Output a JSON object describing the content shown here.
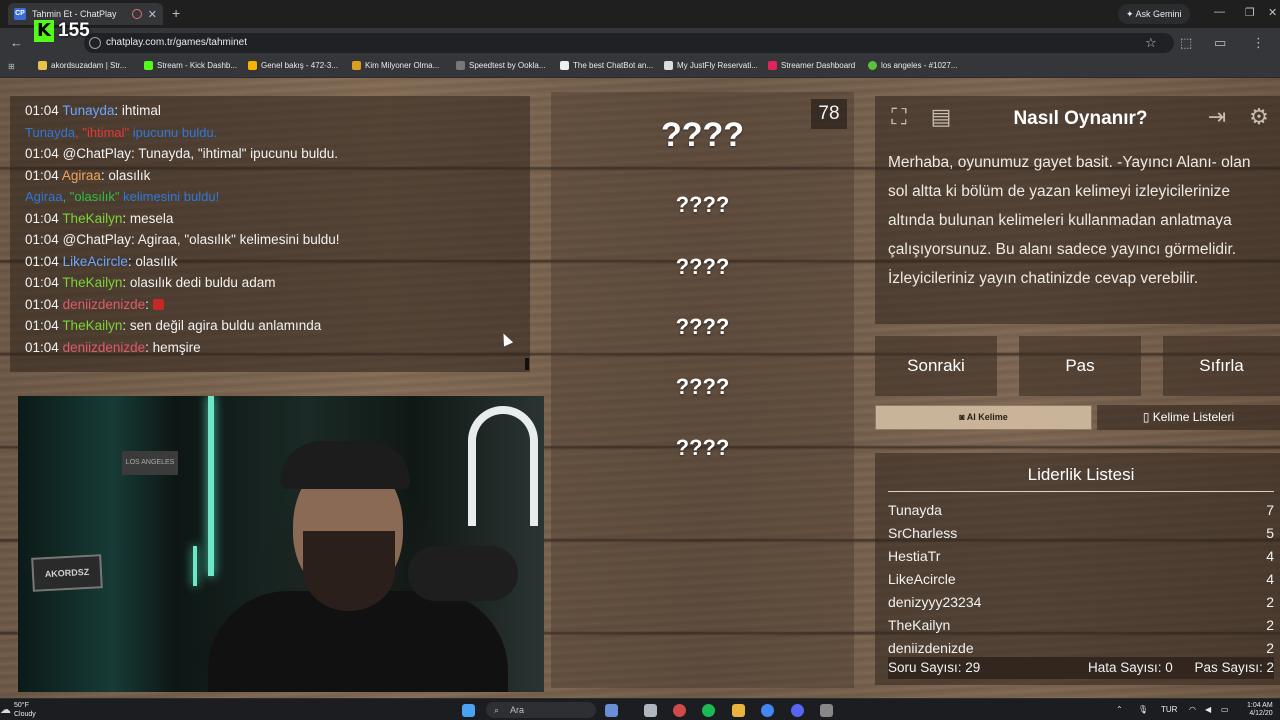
{
  "browser": {
    "tab_title": "Tahmin Et - ChatPlay",
    "tab_favicon": "CP",
    "new_tab": "+",
    "ask_gemini": "Ask Gemini",
    "url": "chatplay.com.tr/games/tahminet",
    "kick_viewers": "155",
    "bookmarks": [
      "akordsuzadam | Str...",
      "Stream - Kick Dashb...",
      "Genel bakış - 472-3...",
      "Kim Milyoner Olma...",
      "Speedtest by Ookla...",
      "The best ChatBot an...",
      "My JustFly Reservati...",
      "Streamer Dashboard",
      "los angeles - #1027..."
    ]
  },
  "chat": {
    "lines": [
      {
        "time": "01:04",
        "user": "Tunayda",
        "msg": ": ihtimal",
        "color": "blue"
      },
      {
        "type": "hint",
        "user": "Tunayda",
        "mid": ", \"ihtimal\"",
        "rest": " ipucunu buldu."
      },
      {
        "time": "01:04",
        "user": "",
        "msg": "@ChatPlay: Tunayda, \"ihtimal\" ipucunu buldu.",
        "color": "none"
      },
      {
        "time": "01:04",
        "user": "Agiraa",
        "msg": ": olasılık",
        "color": "orange"
      },
      {
        "type": "hint2",
        "user": "Agiraa",
        "mid": ", \"olasılık\"",
        "rest": " kelimesini buldu!"
      },
      {
        "time": "01:04",
        "user": "TheKailyn",
        "msg": ": mesela",
        "color": "green"
      },
      {
        "time": "01:04",
        "user": "",
        "msg": "@ChatPlay: Agiraa, \"olasılık\" kelimesini buldu!",
        "color": "none"
      },
      {
        "time": "01:04",
        "user": "LikeAcircle",
        "msg": ": olasılık",
        "color": "blue"
      },
      {
        "time": "01:04",
        "user": "TheKailyn",
        "msg": ": olasılık dedi buldu adam",
        "color": "green"
      },
      {
        "time": "01:04",
        "user": "deniizdenizde",
        "msg": ": ",
        "color": "red",
        "emote": true
      },
      {
        "time": "01:04",
        "user": "TheKailyn",
        "msg": ": sen değil agira buldu anlamında",
        "color": "green"
      },
      {
        "time": "01:04",
        "user": "deniizdenizde",
        "msg": ": hemşire",
        "color": "red"
      }
    ]
  },
  "webcam": {
    "plate_text": "AKORDSZ",
    "sign_text": "LOS ANGELES"
  },
  "words": {
    "main": "????",
    "hidden": [
      "????",
      "????",
      "????",
      "????",
      "????"
    ],
    "timer": "78"
  },
  "howto": {
    "title": "Nasıl Oynanır?",
    "text": "Merhaba, oyunumuz gayet basit. -Yayıncı Alanı- olan sol altta ki bölüm de yazan kelimeyi izleyicilerinize altında bulunan kelimeleri kullanmadan anlatmaya çalışıyorsunuz. Bu alanı sadece yayıncı görmelidir. İzleyicileriniz yayın chatinizde cevap verebilir."
  },
  "controls": {
    "next": "Sonraki",
    "pass": "Pas",
    "reset": "Sıfırla",
    "ai_word": "AI Kelime",
    "word_lists": "Kelime Listeleri"
  },
  "leaderboard": {
    "title": "Liderlik Listesi",
    "rows": [
      {
        "name": "Tunayda",
        "score": "7"
      },
      {
        "name": "SrCharless",
        "score": "5"
      },
      {
        "name": "HestiaTr",
        "score": "4"
      },
      {
        "name": "LikeAcircle",
        "score": "4"
      },
      {
        "name": "denizyyy23234",
        "score": "2"
      },
      {
        "name": "TheKailyn",
        "score": "2"
      },
      {
        "name": "deniizdenizde",
        "score": "2"
      }
    ],
    "question_count": "Soru Sayısı: 29",
    "error_count": "Hata Sayısı: 0",
    "pass_count": "Pas Sayısı: 2"
  },
  "taskbar": {
    "temp": "50°F",
    "weather": "Cloudy",
    "search": "Ara",
    "lang": "TUR",
    "time": "1:04 AM",
    "date": "4/12/20"
  },
  "colors": {
    "kick_green": "#53fc18",
    "user_blue": "#6aa6ff",
    "user_orange": "#f0a35e",
    "user_green": "#7cd336",
    "user_red": "#e05a6a"
  }
}
